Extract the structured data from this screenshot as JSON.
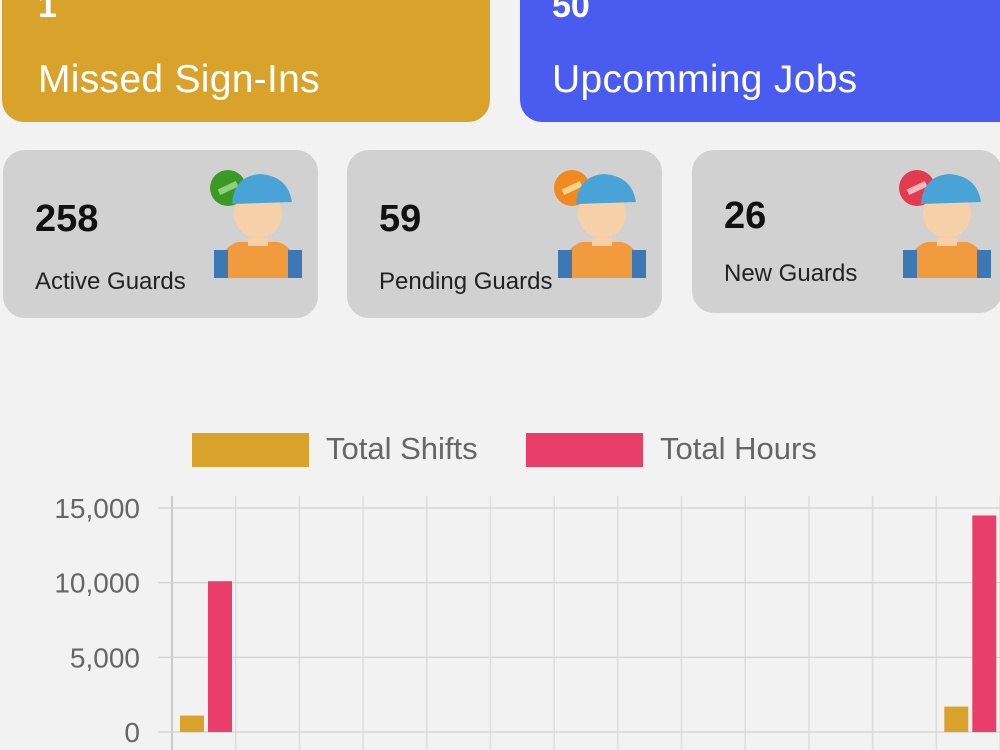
{
  "stats_top": {
    "missed": {
      "count": "1",
      "label": "Missed Sign-Ins",
      "color": "#d9a22a"
    },
    "jobs": {
      "count": "50",
      "label": "Upcomming Jobs",
      "color": "#4a5cf0"
    }
  },
  "guards": [
    {
      "count": "258",
      "label": "Active Guards",
      "badge_color": "#3a9a25"
    },
    {
      "count": "59",
      "label": "Pending Guards",
      "badge_color": "#f08a20"
    },
    {
      "count": "26",
      "label": "New Guards",
      "badge_color": "#e23a4f"
    }
  ],
  "chart_data": {
    "type": "bar",
    "legend": [
      {
        "name": "Total Shifts",
        "color": "#d9a22a"
      },
      {
        "name": "Total Hours",
        "color": "#ea3e6a"
      }
    ],
    "y_ticks": [
      "15,000",
      "10,000",
      "5,000",
      "0"
    ],
    "ylim": [
      0,
      15000
    ],
    "grid": true,
    "categories": [
      "",
      "",
      "",
      "",
      "",
      "",
      "",
      "",
      "",
      "",
      "",
      "",
      ""
    ],
    "series": [
      {
        "name": "Total Shifts",
        "color": "#d9a22a",
        "values": [
          1100,
          0,
          0,
          0,
          0,
          0,
          0,
          0,
          0,
          0,
          0,
          0,
          1700
        ]
      },
      {
        "name": "Total Hours",
        "color": "#ea3e6a",
        "values": [
          10100,
          0,
          0,
          0,
          0,
          0,
          0,
          0,
          0,
          0,
          0,
          0,
          14500
        ]
      }
    ]
  }
}
